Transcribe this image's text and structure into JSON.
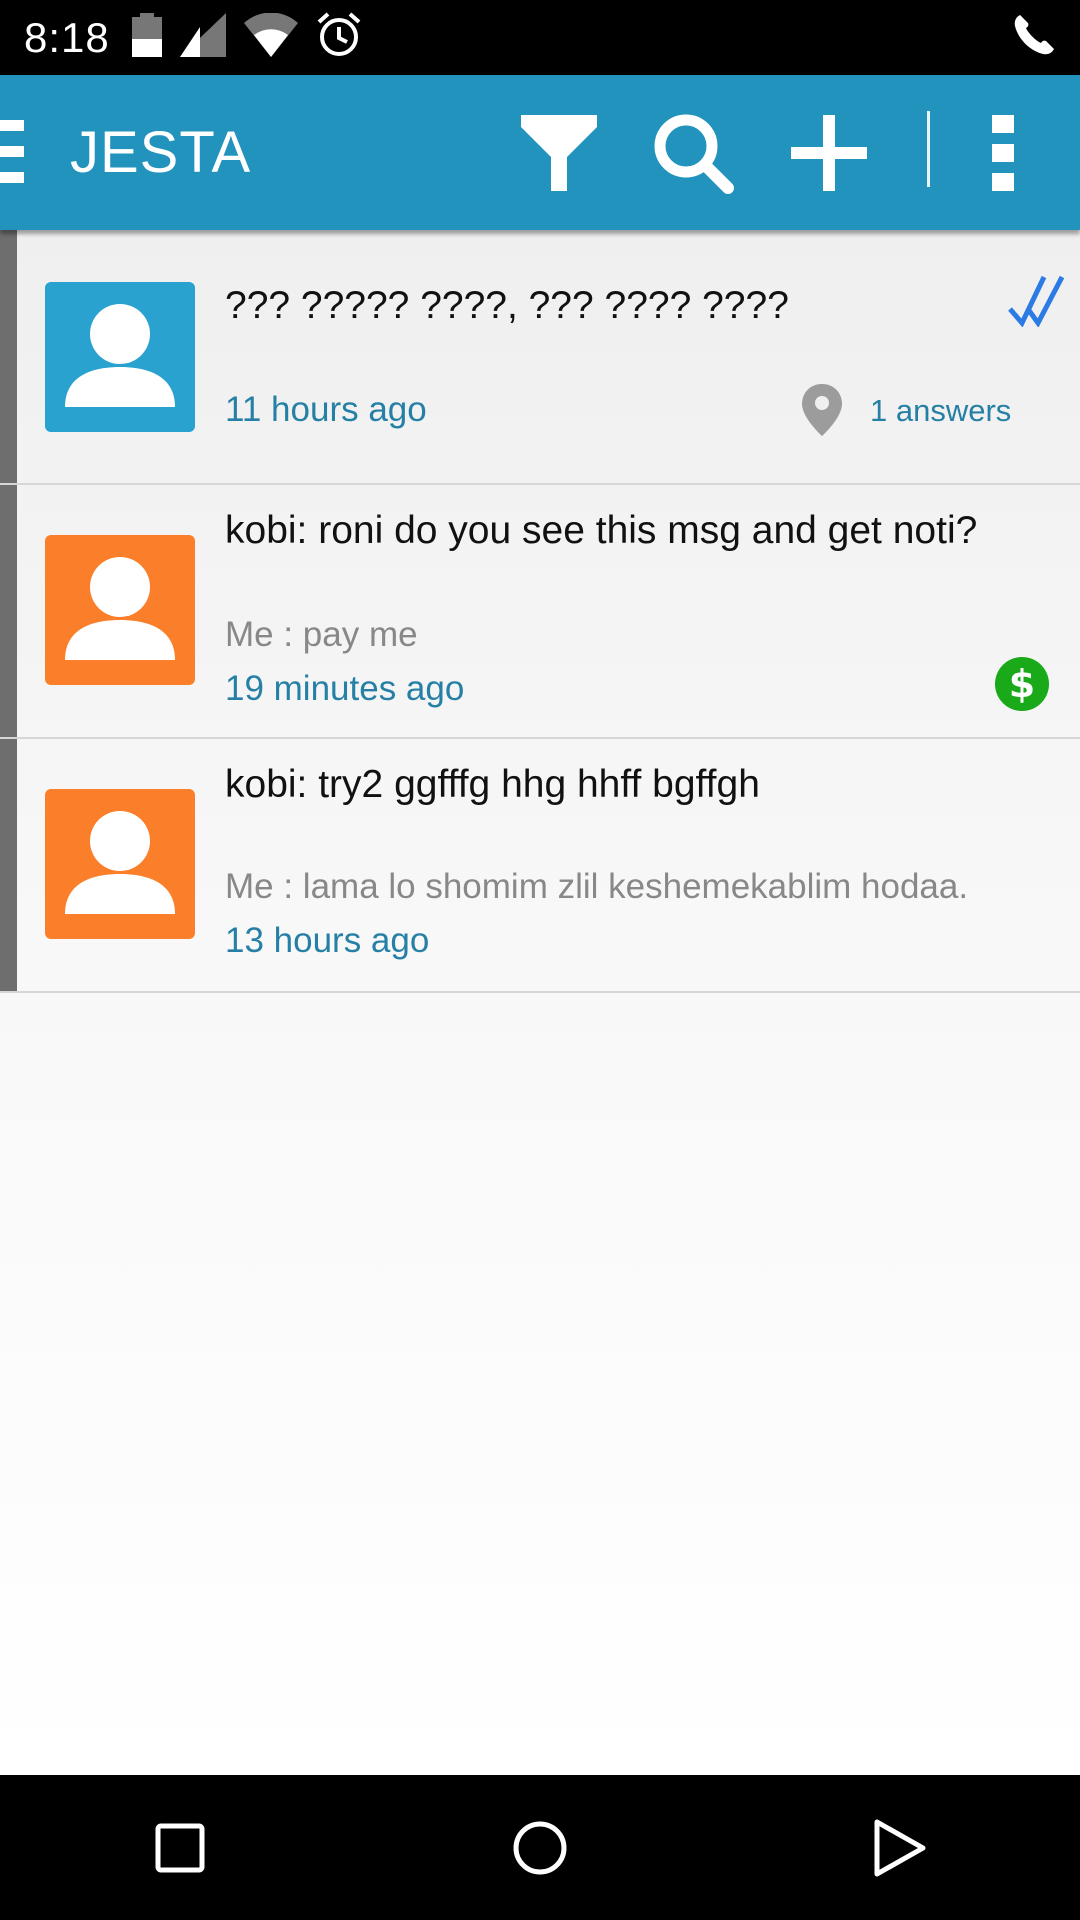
{
  "status_bar": {
    "time": "8:18",
    "icons": [
      "battery-icon",
      "signal-icon",
      "wifi-icon",
      "alarm-icon",
      "phone-icon"
    ]
  },
  "app_bar": {
    "title": "JESTA",
    "actions": [
      "filter-icon",
      "search-icon",
      "add-icon",
      "overflow-menu-icon"
    ],
    "color": "#2293bd"
  },
  "conversations": [
    {
      "title": "??? ????? ????, ??? ???? ????",
      "subtitle": "",
      "time": "11 hours ago",
      "answers": "1 answers",
      "avatar_color": "#2aa2d0",
      "indicators": [
        "double-check-icon",
        "location-pin-icon"
      ]
    },
    {
      "title": "kobi: roni do you see this msg and get noti?",
      "subtitle": "Me : pay me",
      "time": "19 minutes ago",
      "avatar_color": "#fb7f2b",
      "indicators": [
        "dollar-icon"
      ]
    },
    {
      "title": "kobi: try2 ggfffg hhg hhff bgffgh",
      "subtitle": "Me : lama lo shomim zlil keshemekablim hodaa.",
      "time": "13 hours ago",
      "avatar_color": "#fb7f2b",
      "indicators": []
    }
  ],
  "nav_bar": {
    "buttons": [
      "recents-icon",
      "home-icon",
      "back-icon"
    ]
  },
  "colors": {
    "accent_text": "#2680a6",
    "check_blue": "#2c7be5",
    "dollar_green": "#19a919"
  }
}
